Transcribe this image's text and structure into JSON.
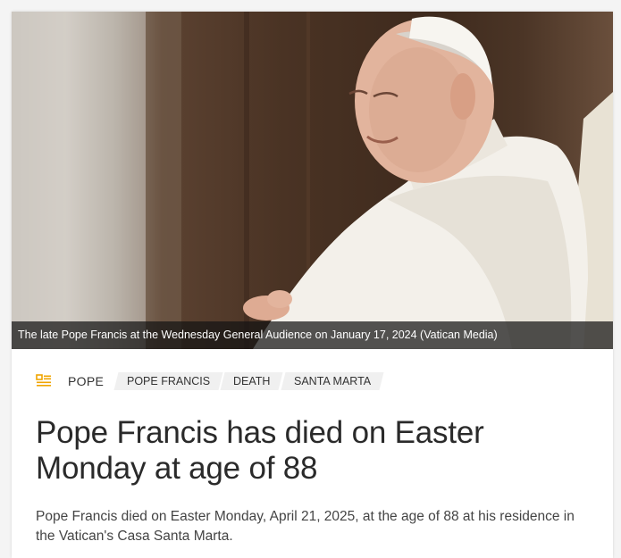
{
  "hero": {
    "caption": "The late Pope Francis at the Wednesday General Audience on January 17, 2024  (Vatican Media)"
  },
  "section": {
    "icon": "article-icon",
    "label": "POPE",
    "accent_color": "#f0a500"
  },
  "tags": [
    "POPE FRANCIS",
    "DEATH",
    "SANTA MARTA"
  ],
  "article": {
    "headline": "Pope Francis has died on Easter Monday at age of 88",
    "summary": "Pope Francis died on Easter Monday, April 21, 2025, at the age of 88 at his residence in the Vatican's Casa Santa Marta."
  }
}
